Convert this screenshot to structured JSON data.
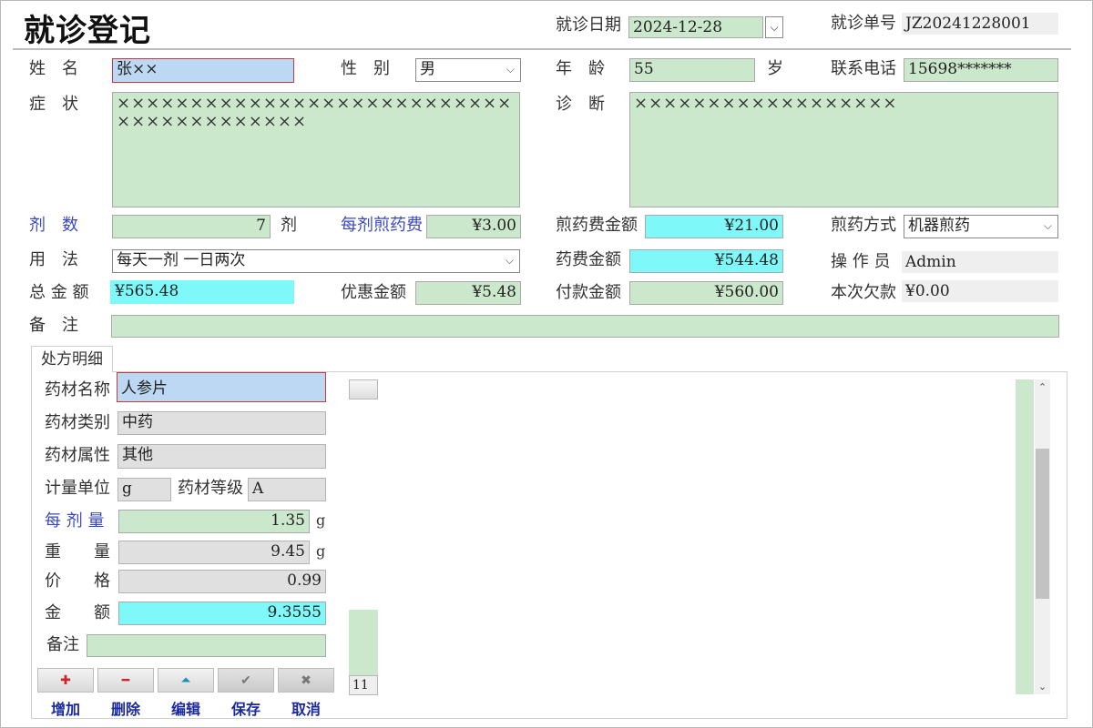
{
  "title": "就诊登记",
  "header": {
    "visit_date_label": "就诊日期",
    "visit_date": "2024-12-28",
    "visit_no_label": "就诊单号",
    "visit_no": "JZ20241228001"
  },
  "patient": {
    "name_label": "姓　名",
    "name": "张××",
    "gender_label": "性　别",
    "gender": "男",
    "age_label": "年　龄",
    "age": "55",
    "age_unit": "岁",
    "phone_label": "联系电话",
    "phone": "15698*******",
    "symptom_label": "症　状",
    "symptom": "××××××××××××××××××××××××××××××××××××××××",
    "diagnosis_label": "诊　断",
    "diagnosis": "××××××××××××××××××"
  },
  "billing": {
    "doses_label": "剂　数",
    "doses": "7",
    "doses_unit": "剂",
    "decoct_fee_per_label": "每剂煎药费",
    "decoct_fee_per": "¥3.00",
    "decoct_total_label": "煎药费金额",
    "decoct_total": "¥21.00",
    "decoct_method_label": "煎药方式",
    "decoct_method": "机器煎药",
    "usage_label": "用　法",
    "usage": "每天一剂 一日两次",
    "drug_total_label": "药费金额",
    "drug_total": "¥544.48",
    "operator_label": "操 作 员",
    "operator": "Admin",
    "total_label": "总 金 额",
    "total": "¥565.48",
    "discount_label": "优惠金额",
    "discount": "¥5.48",
    "paid_label": "付款金额",
    "paid": "¥560.00",
    "owed_label": "本次欠款",
    "owed": "¥0.00",
    "remark_label": "备　注",
    "remark": ""
  },
  "prescription": {
    "tab_label": "处方明细",
    "herb_name_label": "药材名称",
    "herb_name": "人参片",
    "herb_type_label": "药材类别",
    "herb_type": "中药",
    "herb_attr_label": "药材属性",
    "herb_attr": "其他",
    "unit_label": "计量单位",
    "unit": "g",
    "grade_label": "药材等级",
    "grade": "A",
    "per_dose_label": "每 剂 量",
    "per_dose": "1.35",
    "per_dose_unit": "g",
    "weight_label": "重　　量",
    "weight": "9.45",
    "weight_unit": "g",
    "price_label": "价　　格",
    "price": "0.99",
    "amount_label": "金　　额",
    "amount": "9.3555",
    "remark_label": "备注",
    "remark": "",
    "record_count": "11"
  },
  "toolbar": {
    "add": "增加",
    "delete": "删除",
    "edit": "编辑",
    "save": "保存",
    "cancel": "取消",
    "add_glyph": "✚",
    "delete_glyph": "━",
    "edit_glyph": "⏶",
    "save_glyph": "✔",
    "cancel_glyph": "✖"
  },
  "colors": {
    "field_green": "#cce8cc",
    "field_cyan": "#7ef8f8",
    "label_blue": "#3a48c4"
  }
}
